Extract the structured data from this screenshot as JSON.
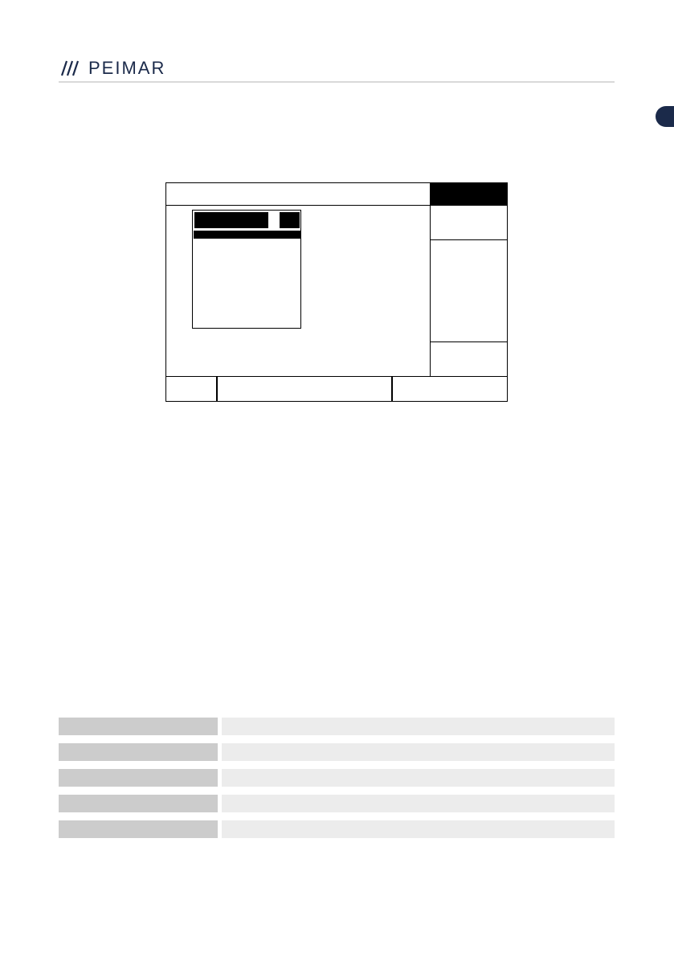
{
  "brand": {
    "name": "PEIMAR",
    "color": "#1b2a4a",
    "mark_icon": "triple-slash-icon"
  },
  "colors": {
    "rule": "#d9d9d9",
    "table_key_bg": "#cccccc",
    "table_value_bg": "#ececec",
    "tab": "#1b2a4a"
  },
  "screen": {
    "title": "",
    "softkeys": [
      "",
      "",
      "",
      "",
      ""
    ],
    "status": [
      "",
      "",
      ""
    ],
    "popup": {
      "header": "",
      "items": [
        "",
        "",
        "",
        "",
        "",
        ""
      ]
    }
  },
  "legend": {
    "rows": [
      {
        "key": "",
        "value": ""
      },
      {
        "key": "",
        "value": ""
      },
      {
        "key": "",
        "value": ""
      },
      {
        "key": "",
        "value": ""
      },
      {
        "key": "",
        "value": ""
      }
    ]
  }
}
